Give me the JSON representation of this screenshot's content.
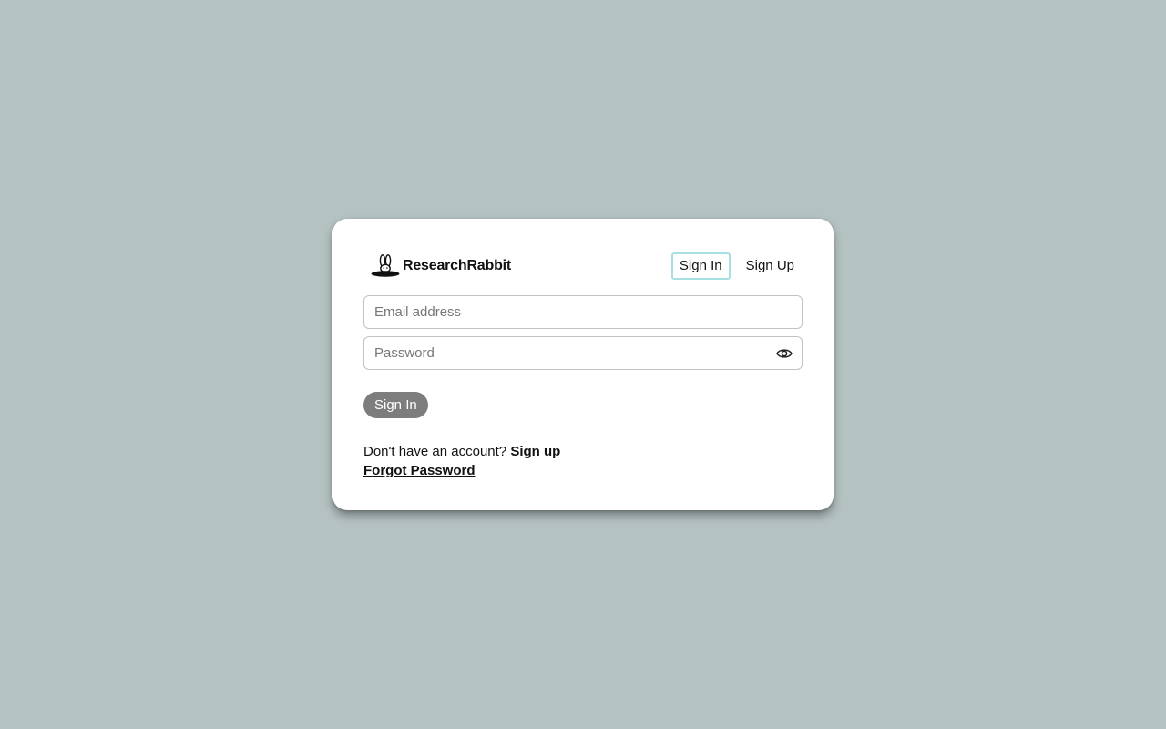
{
  "brand": {
    "name": "ResearchRabbit",
    "logo_icon": "rabbit-in-hat-icon"
  },
  "auth_tabs": [
    {
      "label": "Sign In",
      "active": true
    },
    {
      "label": "Sign Up",
      "active": false
    }
  ],
  "form": {
    "email": {
      "value": "",
      "placeholder": "Email address"
    },
    "password": {
      "value": "",
      "placeholder": "Password",
      "toggle_icon": "eye-icon"
    },
    "submit_label": "Sign In"
  },
  "footer": {
    "no_account_text": "Don't have an account?",
    "signup_link": "Sign up",
    "forgot_password": "Forgot Password"
  },
  "colors": {
    "background": "#b5c2c2",
    "card": "#ffffff",
    "active_tab_border": "#a6e0e2",
    "submit_button": "#7d7d7d"
  }
}
